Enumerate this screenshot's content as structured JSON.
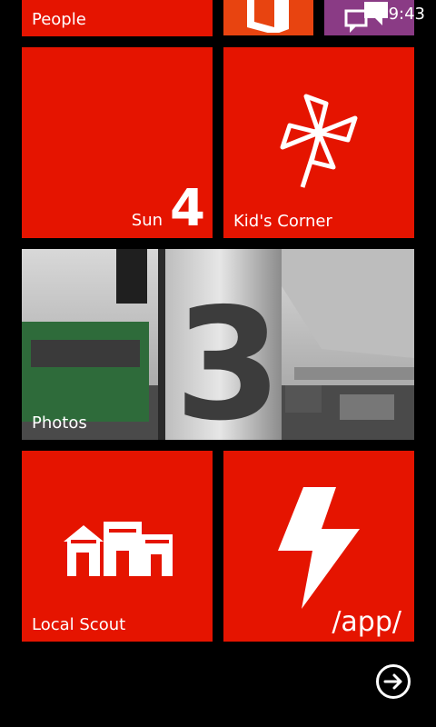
{
  "status_bar": {
    "time": "9:43"
  },
  "tiles": {
    "people": {
      "label": "People",
      "icon": "people-icon"
    },
    "office": {
      "icon": "office-icon",
      "color": "#e84410"
    },
    "messaging": {
      "icon": "messaging-icon",
      "color": "#8a3b85"
    },
    "calendar": {
      "day": "Sun",
      "date": "4",
      "icon": "calendar-icon"
    },
    "kids_corner": {
      "label": "Kid's Corner",
      "icon": "pinwheel-icon"
    },
    "photos": {
      "label": "Photos",
      "icon": "photos-icon"
    },
    "local_scout": {
      "label": "Local Scout",
      "icon": "buildings-icon"
    },
    "app": {
      "label": "/app/",
      "icon": "lightning-icon"
    }
  },
  "accent_color": "#e51400",
  "nav": {
    "all_apps_icon": "arrow-right-icon"
  }
}
